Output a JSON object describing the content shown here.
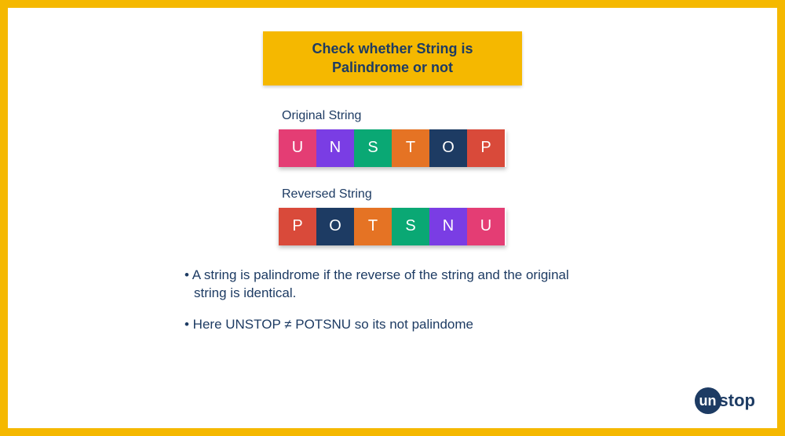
{
  "title": "Check whether String is Palindrome or not",
  "originalLabel": "Original String",
  "reversedLabel": "Reversed String",
  "originalCells": [
    {
      "letter": "U",
      "color": "#e43d74"
    },
    {
      "letter": "N",
      "color": "#7a3de4"
    },
    {
      "letter": "S",
      "color": "#0aa874"
    },
    {
      "letter": "T",
      "color": "#e57324"
    },
    {
      "letter": "O",
      "color": "#1d3b63"
    },
    {
      "letter": "P",
      "color": "#d94a3a"
    }
  ],
  "reversedCells": [
    {
      "letter": "P",
      "color": "#d94a3a"
    },
    {
      "letter": "O",
      "color": "#1d3b63"
    },
    {
      "letter": "T",
      "color": "#e57324"
    },
    {
      "letter": "S",
      "color": "#0aa874"
    },
    {
      "letter": "N",
      "color": "#7a3de4"
    },
    {
      "letter": "U",
      "color": "#e43d74"
    }
  ],
  "bullets": [
    "• A string is palindrome if the reverse of the string and the original string is identical.",
    "• Here UNSTOP ≠ POTSNU so its not palindome"
  ],
  "logo": {
    "prefix": "un",
    "suffix": "stop"
  }
}
